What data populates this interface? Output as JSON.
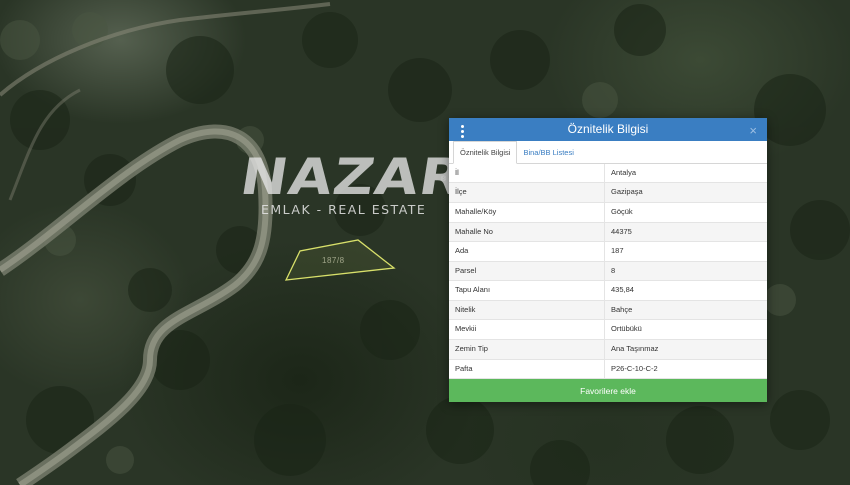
{
  "logo": {
    "word": "NAZAR",
    "tagline": "EMLAK - REAL ESTATE",
    "mark": "®"
  },
  "map": {
    "parcel_label": "187/8"
  },
  "panel": {
    "title": "Öznitelik Bilgisi",
    "close": "×",
    "tabs": [
      {
        "label": "Öznitelik Bilgisi",
        "active": true
      },
      {
        "label": "Bina/BB Listesi",
        "active": false
      }
    ],
    "rows": [
      {
        "key": "İl",
        "value": "Antalya"
      },
      {
        "key": "İlçe",
        "value": "Gazipaşa"
      },
      {
        "key": "Mahalle/Köy",
        "value": "Göçük"
      },
      {
        "key": "Mahalle No",
        "value": "44375"
      },
      {
        "key": "Ada",
        "value": "187"
      },
      {
        "key": "Parsel",
        "value": "8"
      },
      {
        "key": "Tapu Alanı",
        "value": "435,84"
      },
      {
        "key": "Nitelik",
        "value": "Bahçe"
      },
      {
        "key": "Mevkii",
        "value": "Ortübükü"
      },
      {
        "key": "Zemin Tip",
        "value": "Ana Taşınmaz"
      },
      {
        "key": "Pafta",
        "value": "P26-C-10-C-2"
      }
    ],
    "favorite_button": "Favorilere ekle"
  },
  "colors": {
    "header": "#3a7ec2",
    "button": "#5cb85c",
    "parcel_outline": "#d8e06a"
  }
}
